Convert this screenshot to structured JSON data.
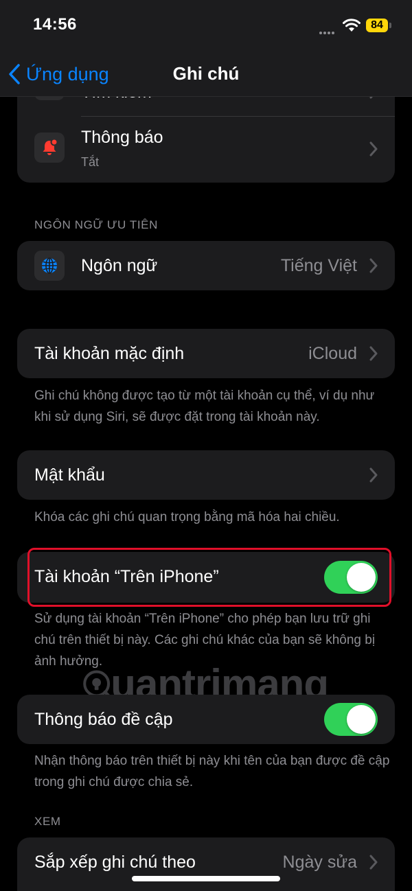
{
  "status_bar": {
    "time": "14:56",
    "battery": "84"
  },
  "nav": {
    "back_label": "Ứng dụng",
    "title": "Ghi chú"
  },
  "notifications_card": {
    "partial_label": "Tìm kiếm",
    "label": "Thông báo",
    "subtitle": "Tắt"
  },
  "preferred_language": {
    "header": "NGÔN NGỮ ƯU TIÊN",
    "label": "Ngôn ngữ",
    "value": "Tiếng Việt"
  },
  "default_account": {
    "label": "Tài khoản mặc định",
    "value": "iCloud",
    "footer": "Ghi chú không được tạo từ một tài khoản cụ thể, ví dụ như khi sử dụng Siri, sẽ được đặt trong tài khoản này."
  },
  "password": {
    "label": "Mật khẩu",
    "footer": "Khóa các ghi chú quan trọng bằng mã hóa hai chiều."
  },
  "on_iphone_account": {
    "label": "Tài khoản “Trên iPhone”",
    "enabled": true,
    "footer": "Sử dụng tài khoản “Trên iPhone” cho phép bạn lưu trữ ghi chú trên thiết bị này. Các ghi chú khác của bạn sẽ không bị ảnh hưởng."
  },
  "mention_notifications": {
    "label": "Thông báo đề cập",
    "enabled": true,
    "footer": "Nhận thông báo trên thiết bị này khi tên của bạn được đề cập trong ghi chú được chia sẻ."
  },
  "view_section": {
    "header": "XEM",
    "sort_label": "Sắp xếp ghi chú theo",
    "sort_value": "Ngày sửa"
  },
  "watermark": {
    "text": "uantrimang"
  },
  "colors": {
    "accent": "#0a84ff",
    "toggle_on": "#30d158",
    "highlight": "#e0102a",
    "battery": "#ffd60a",
    "notification_icon": "#ff3b30"
  },
  "icons": {
    "back": "chevron-left-icon",
    "notifications": "bell-badge-icon",
    "language": "globe-icon",
    "disclosure": "chevron-right-icon"
  }
}
